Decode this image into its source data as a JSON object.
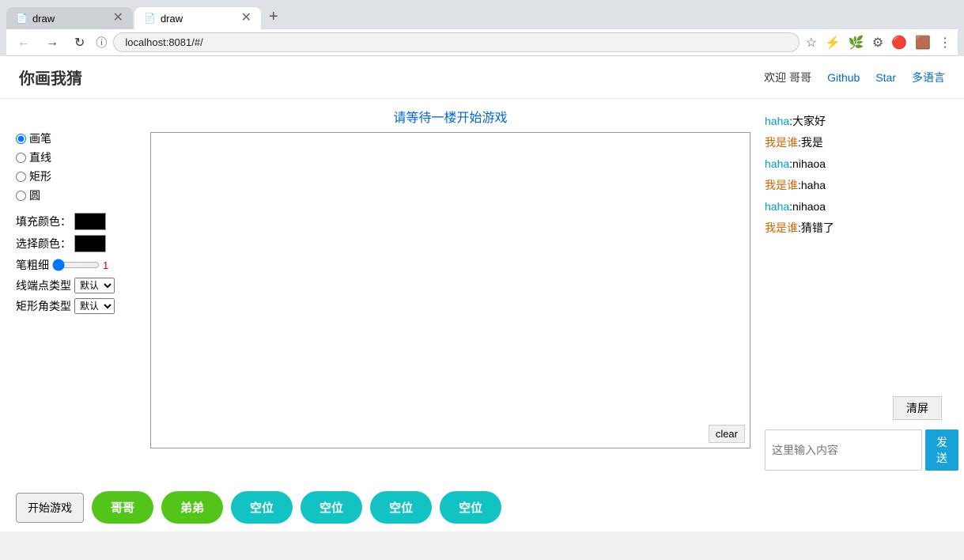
{
  "browser": {
    "tabs": [
      {
        "id": "tab1",
        "label": "draw",
        "active": false,
        "favicon": "📄",
        "url": "localhost:8081/#/"
      },
      {
        "id": "tab2",
        "label": "draw",
        "active": true,
        "favicon": "📄",
        "url": "localhost:8081/#/"
      }
    ],
    "address": "localhost:8081/#/",
    "new_tab_label": "+"
  },
  "header": {
    "logo": "你画我猜",
    "nav": {
      "welcome": "欢迎 哥哥",
      "github": "Github",
      "star": "Star",
      "lang": "多语言"
    }
  },
  "game": {
    "status": "请等待一楼开始游戏"
  },
  "toolbar": {
    "tools": [
      {
        "id": "pen",
        "label": "画笔",
        "checked": true
      },
      {
        "id": "line",
        "label": "直线",
        "checked": false
      },
      {
        "id": "rect",
        "label": "矩形",
        "checked": false
      },
      {
        "id": "circle",
        "label": "圆",
        "checked": false
      }
    ],
    "fill_color_label": "填充颜色：",
    "select_color_label": "选择颜色：",
    "stroke_label": "笔粗细",
    "stroke_value": "1",
    "line_end_label": "线端点类型",
    "line_end_default": "默认",
    "rect_corner_label": "矩形角类型",
    "rect_corner_default": "默认"
  },
  "canvas": {
    "clear_btn": "clear"
  },
  "chat": {
    "messages": [
      {
        "sender": "haha",
        "content": "大家好",
        "color": "blue"
      },
      {
        "sender": "我是谁",
        "content": "我是",
        "color": "orange"
      },
      {
        "sender": "haha",
        "content": "nihaoa",
        "color": "blue"
      },
      {
        "sender": "我是谁",
        "content": "haha",
        "color": "orange"
      },
      {
        "sender": "haha",
        "content": "nihaoa",
        "color": "blue"
      },
      {
        "sender": "我是谁",
        "content": "猜错了",
        "color": "orange"
      }
    ],
    "clear_screen_btn": "清屏",
    "input_placeholder": "这里输入内容",
    "send_btn": "发送"
  },
  "bottom_bar": {
    "start_btn": "开始游戏",
    "players": [
      {
        "id": "p1",
        "label": "哥哥",
        "color": "green"
      },
      {
        "id": "p2",
        "label": "弟弟",
        "color": "green"
      },
      {
        "id": "p3",
        "label": "空位",
        "color": "teal"
      },
      {
        "id": "p4",
        "label": "空位",
        "color": "teal"
      },
      {
        "id": "p5",
        "label": "空位",
        "color": "teal"
      },
      {
        "id": "p6",
        "label": "空位",
        "color": "teal"
      }
    ]
  }
}
